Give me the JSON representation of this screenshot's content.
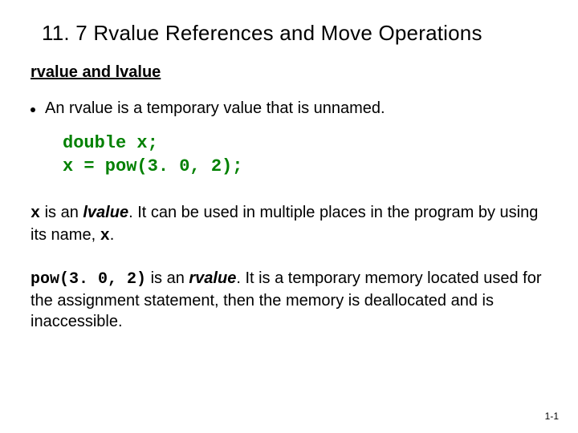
{
  "title": "11. 7  Rvalue References and Move Operations",
  "subhead": "rvalue and lvalue",
  "bullet": {
    "pre": "An ",
    "term": "rvalue",
    "post": " is a temporary value that is unnamed."
  },
  "code": {
    "line1": "double x;",
    "line2": "x = pow(3. 0, 2);"
  },
  "p1": {
    "x": "x",
    "a": " is an ",
    "lv": "lvalue",
    "b": ".  It can be used in multiple places in the program by using its name, ",
    "x2": "x",
    "c": "."
  },
  "p2": {
    "pow": "pow(3. 0, 2)",
    "a": " is an ",
    "rv": "rvalue",
    "b": ".  It is a temporary memory located used for the assignment statement, then the memory is deallocated and is inaccessible."
  },
  "pagenum": "1-1"
}
